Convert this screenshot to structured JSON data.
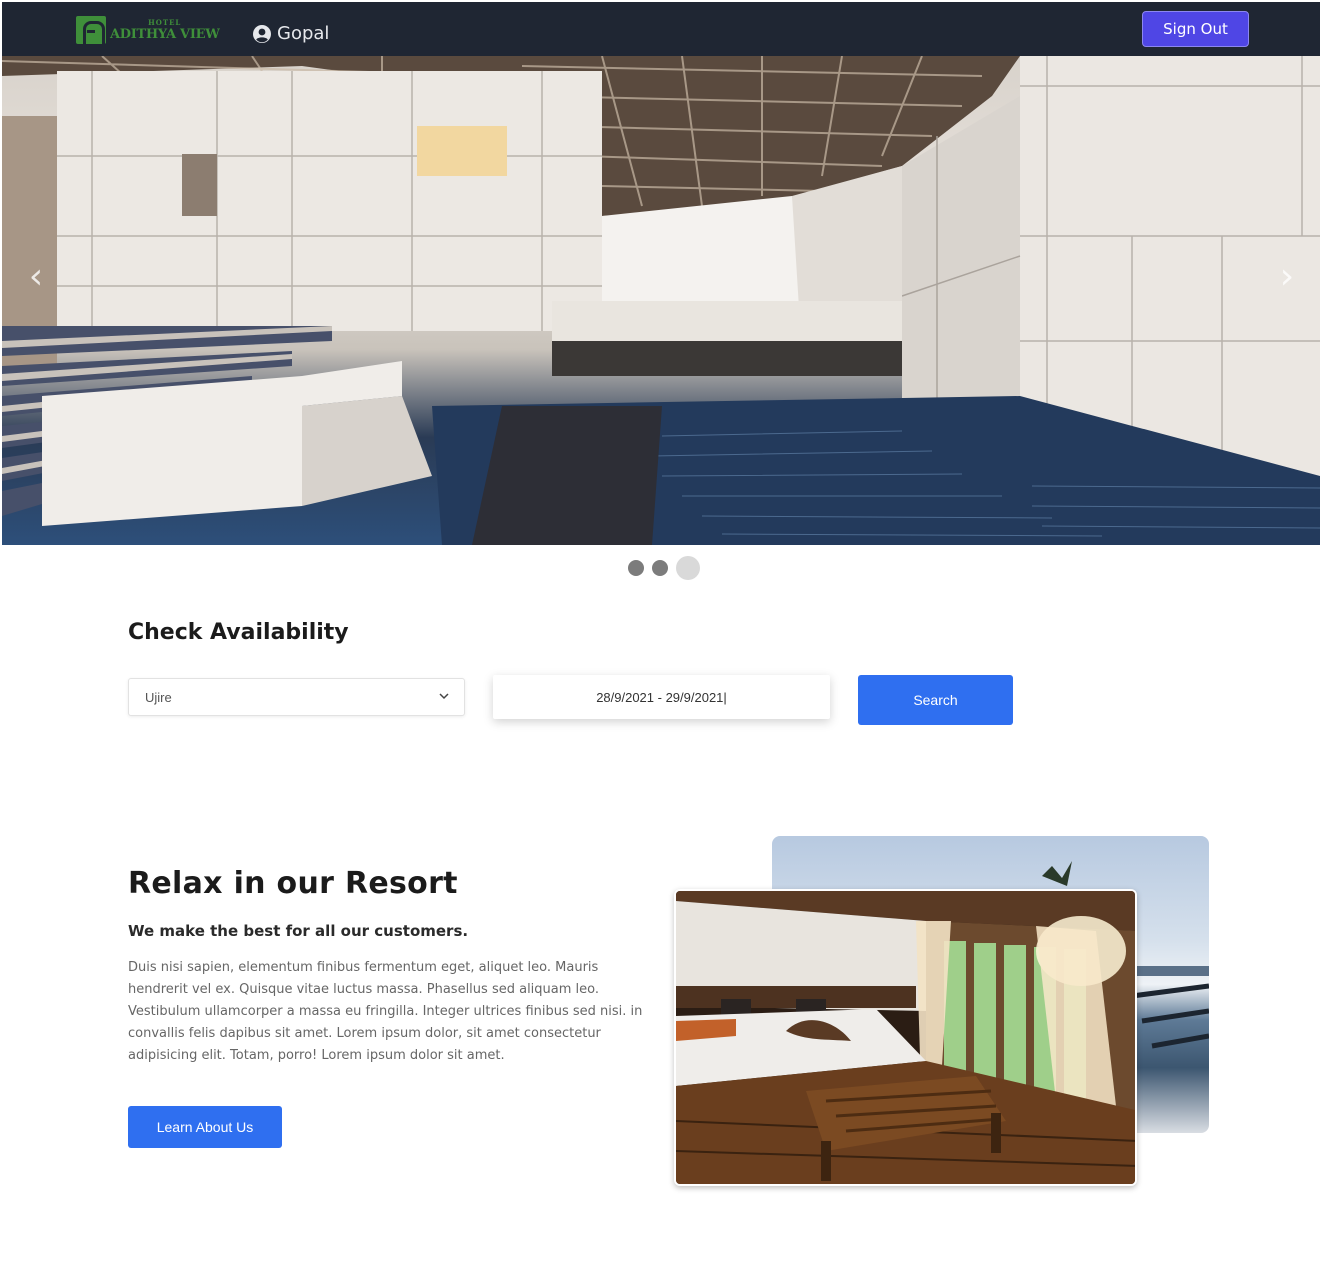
{
  "navbar": {
    "logo_small": "HOTEL",
    "logo_big": "ADITHYA VIEW",
    "user_name": "Gopal",
    "signout_label": "Sign Out"
  },
  "hero": {
    "prev_glyph": "‹",
    "next_glyph": "›",
    "slides": 3,
    "active_slide": 3
  },
  "check": {
    "title": "Check Availability",
    "location_value": "Ujire",
    "date_range": "28/9/2021 - 29/9/2021|",
    "search_label": "Search"
  },
  "about": {
    "title": "Relax in our Resort",
    "subtitle": "We make the best for all our customers.",
    "body": "Duis nisi sapien, elementum finibus fermentum eget, aliquet leo. Mauris hendrerit vel ex. Quisque vitae luctus massa. Phasellus sed aliquam leo. Vestibulum ullamcorper a massa eu fringilla. Integer ultrices finibus sed nisi. in convallis felis dapibus sit amet. Lorem ipsum dolor, sit amet consectetur adipisicing elit. Totam, porro! Lorem ipsum dolor sit amet.",
    "button_label": "Learn About Us"
  },
  "colors": {
    "navbar": "#1f2633",
    "signout": "#4f46e5",
    "primary": "#2f6ff0",
    "logo_green": "#3f8f3a"
  },
  "icons": {
    "user": "user-circle-icon",
    "chevron": "chevron-down-icon",
    "prev": "chevron-left-icon",
    "next": "chevron-right-icon"
  }
}
